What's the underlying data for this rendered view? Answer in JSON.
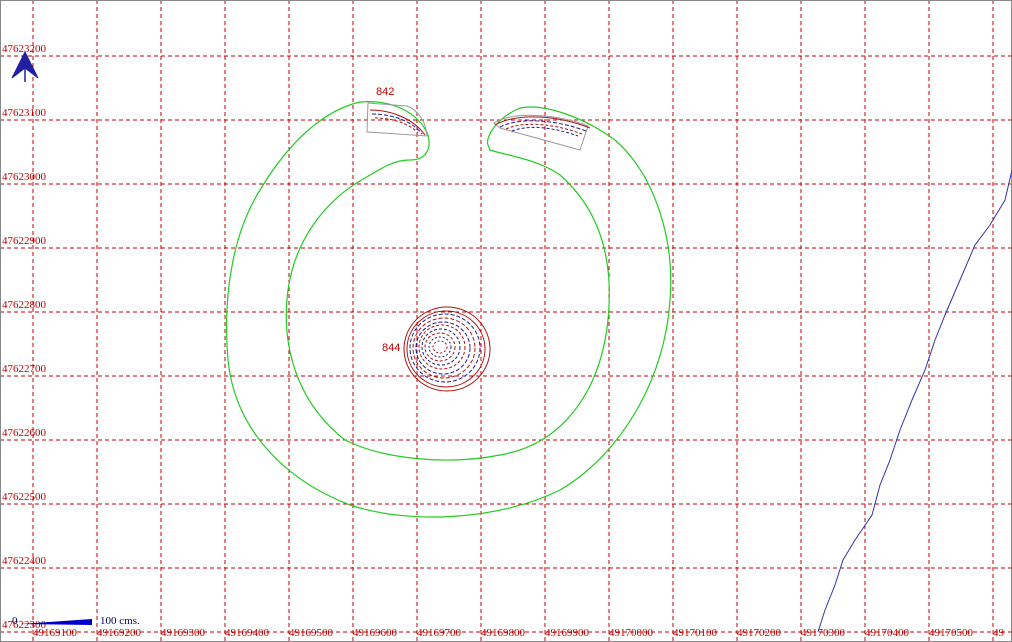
{
  "map": {
    "x_ticks": [
      "49169100",
      "49169200",
      "49169300",
      "49169400",
      "49169500",
      "49169600",
      "49169700",
      "49169800",
      "49169900",
      "49170000",
      "49170100",
      "49170200",
      "49170300",
      "49170400",
      "49170500",
      "49"
    ],
    "y_ticks": [
      "47623200",
      "47623100",
      "47623000",
      "47622900",
      "47622800",
      "47622700",
      "47622600",
      "47622500",
      "47622400",
      "47622300"
    ],
    "contour_labels": [
      "842",
      "844"
    ],
    "scale": {
      "zero": "0",
      "label": "100 cms."
    },
    "colors": {
      "grid": "#c00000",
      "contour_outer": "#22cc22",
      "contour_inner": "#b01010",
      "contour_dashed": "#1a1a9a",
      "river": "#3333aa",
      "north_arrow": "#2020a0"
    },
    "icons": {
      "north_arrow": "north-arrow-icon"
    }
  }
}
